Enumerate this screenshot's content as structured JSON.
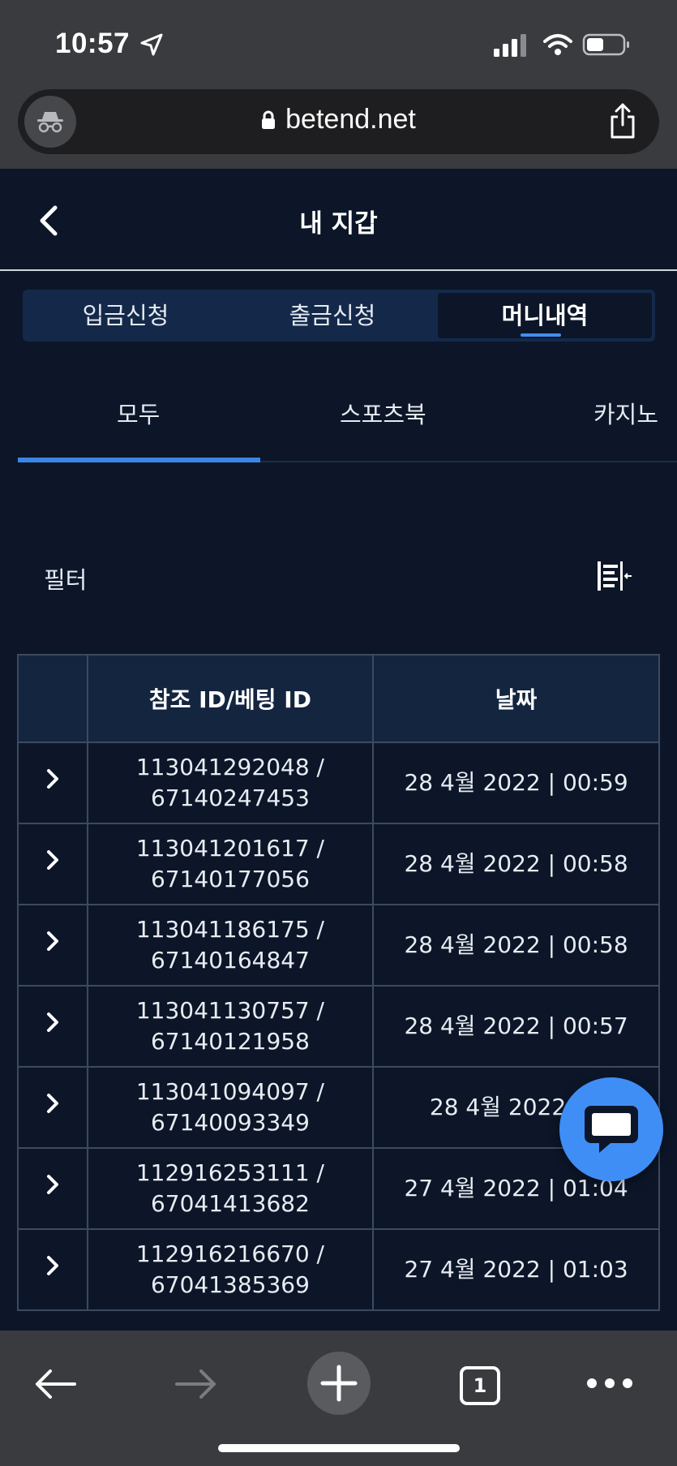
{
  "status_bar": {
    "time": "10:57"
  },
  "browser": {
    "url": "betend.net",
    "tab_count": "1"
  },
  "header": {
    "title": "내 지갑"
  },
  "segment_tabs": [
    {
      "label": "입금신청"
    },
    {
      "label": "출금신청"
    },
    {
      "label": "머니내역",
      "active": true
    }
  ],
  "category_tabs": [
    {
      "label": "모두",
      "active": true
    },
    {
      "label": "스포츠북"
    },
    {
      "label": "카지노"
    }
  ],
  "filter": {
    "label": "필터"
  },
  "table": {
    "headers": {
      "expand": "",
      "reference": "참조 ID/베팅 ID",
      "date": "날짜"
    },
    "rows": [
      {
        "ref_id": "113041292048 /",
        "bet_id": "67140247453",
        "date": "28 4월 2022 | 00:59"
      },
      {
        "ref_id": "113041201617 /",
        "bet_id": "67140177056",
        "date": "28 4월 2022 | 00:58"
      },
      {
        "ref_id": "113041186175 /",
        "bet_id": "67140164847",
        "date": "28 4월 2022 | 00:58"
      },
      {
        "ref_id": "113041130757 /",
        "bet_id": "67140121958",
        "date": "28 4월 2022 | 00:57"
      },
      {
        "ref_id": "113041094097 /",
        "bet_id": "67140093349",
        "date": "28 4월 2022 | 0"
      },
      {
        "ref_id": "112916253111 /",
        "bet_id": "67041413682",
        "date": "27 4월 2022 | 01:04"
      },
      {
        "ref_id": "112916216670 /",
        "bet_id": "67041385369",
        "date": "27 4월 2022 | 01:03"
      }
    ]
  },
  "colors": {
    "background": "#0c1628",
    "accent": "#3f8ef5",
    "header_cell": "#142540"
  }
}
